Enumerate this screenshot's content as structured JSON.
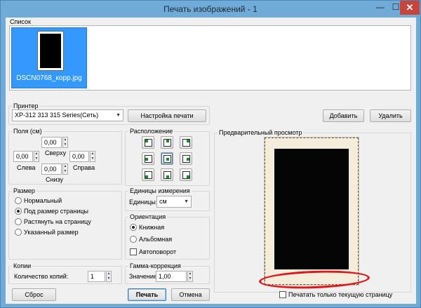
{
  "window": {
    "title": "Печать изображений - 1",
    "min_glyph": "—",
    "max_glyph": "☐",
    "close_glyph": "✕"
  },
  "list_group": {
    "title": "Список",
    "items": [
      {
        "label": "DSCN0768_корр.jpg",
        "selected": true
      }
    ]
  },
  "printer_group": {
    "title": "Принтер",
    "selected_printer": "XP-312 313 315 Series(Сеть)",
    "settings_button": "Настройка печати"
  },
  "list_actions": {
    "add_button": "Добавить",
    "remove_button": "Удалить"
  },
  "margins_group": {
    "title": "Поля (см)",
    "top": {
      "label": "Сверху",
      "value": "0,00"
    },
    "left": {
      "label": "Слева",
      "value": "0,00"
    },
    "right": {
      "label": "Справа",
      "value": "0,00"
    },
    "bottom": {
      "label": "Снизу",
      "value": "0,00"
    }
  },
  "placement_group": {
    "title": "Расположение",
    "selected": "center"
  },
  "preview_group": {
    "title": "Предварительный просмотр"
  },
  "size_group": {
    "title": "Размер",
    "options": [
      {
        "label": "Нормальный",
        "selected": false
      },
      {
        "label": "Под размер страницы",
        "selected": true
      },
      {
        "label": "Растянуть на страницу",
        "selected": false
      },
      {
        "label": "Указанный размер",
        "selected": false
      }
    ]
  },
  "units_group": {
    "title": "Единицы измерения",
    "label": "Единицы:",
    "value": "см"
  },
  "orientation_group": {
    "title": "Ориентация",
    "portrait": {
      "label": "Книжная",
      "selected": true
    },
    "landscape": {
      "label": "Альбомная",
      "selected": false
    },
    "autorotate": {
      "label": "Автоповорот",
      "checked": false
    }
  },
  "copies_group": {
    "title": "Копии",
    "label": "Количество копий:",
    "value": "1"
  },
  "gamma_group": {
    "title": "Гамма-коррекция",
    "label": "Значение:",
    "value": "1,00"
  },
  "footer": {
    "reset_button": "Сброс",
    "print_button": "Печать",
    "cancel_button": "Отмена",
    "print_current_page_label": "Печатать только текущую страницу",
    "print_current_page_checked": false
  },
  "colors": {
    "titlebar": "#70aad7",
    "close": "#c7443a",
    "selection": "#3399ff",
    "annotation": "#e0161c",
    "position_marker": "#1b8a24"
  }
}
